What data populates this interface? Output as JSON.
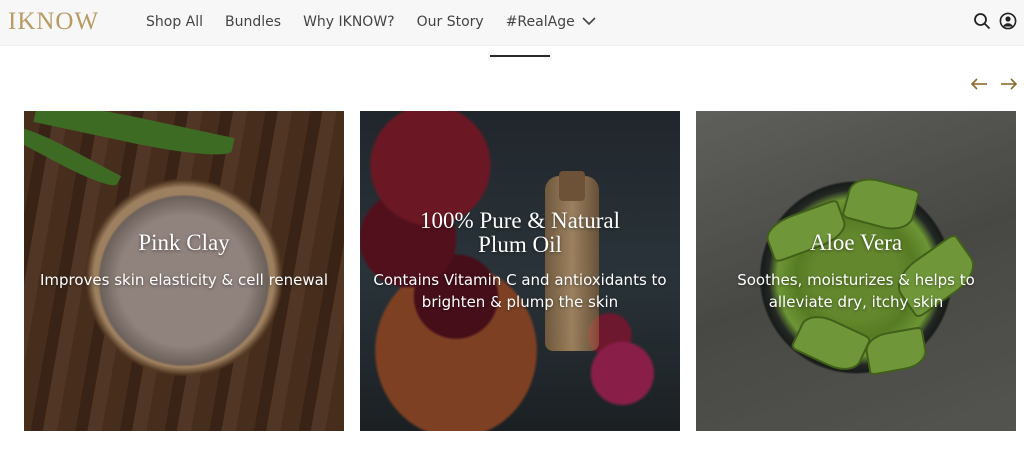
{
  "brand": {
    "logo_text": "IKNOW"
  },
  "nav": {
    "items": [
      {
        "label": "Shop All"
      },
      {
        "label": "Bundles"
      },
      {
        "label": "Why IKNOW?"
      },
      {
        "label": "Our Story"
      },
      {
        "label": "#RealAge"
      }
    ]
  },
  "header_icons": [
    "search-icon",
    "account-icon"
  ],
  "carousel_controls": [
    "arrow-left-icon",
    "arrow-right-icon"
  ],
  "cards": [
    {
      "title": "Pink Clay",
      "description": "Improves skin elasticity & cell renewal"
    },
    {
      "title_line1": "100% Pure & Natural",
      "title_line2": "Plum Oil",
      "description": "Contains Vitamin C and antioxidants to brighten & plump the skin"
    },
    {
      "title": "Aloe Vera",
      "description": "Soothes, moisturizes & helps to alleviate dry, itchy skin"
    }
  ],
  "colors": {
    "accent_gold": "#b89a63",
    "nav_text": "#444444",
    "header_bg": "#f7f7f7"
  }
}
